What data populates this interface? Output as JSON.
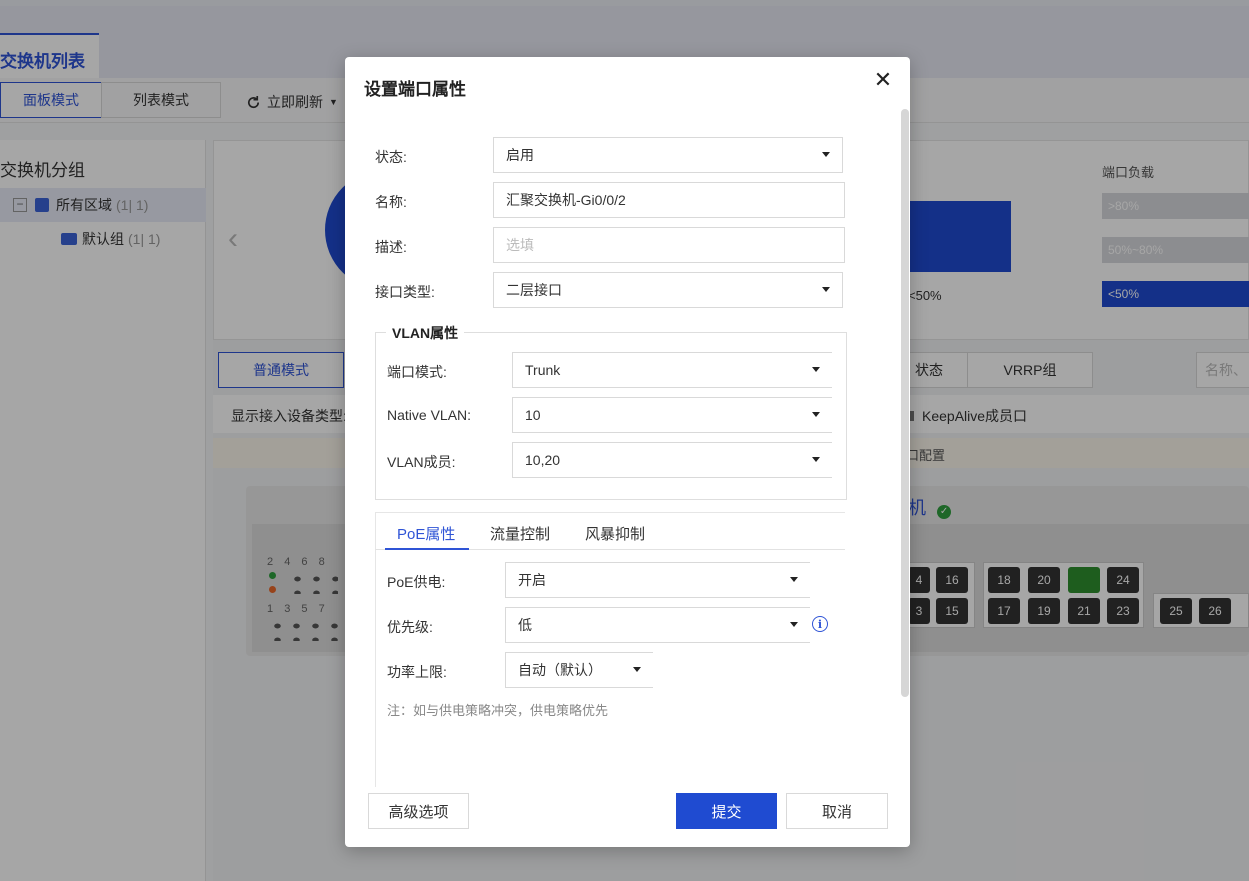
{
  "background": {
    "tab_title": "交换机列表",
    "modes": [
      "面板模式",
      "列表模式"
    ],
    "refresh_label": "立即刷新",
    "left_title": "交换机分组",
    "tree": [
      {
        "label": "所有区域",
        "count": "(1| 1)"
      },
      {
        "label": "默认组",
        "count": "(1| 1)"
      }
    ],
    "load_title": "端口负载",
    "load_levels": [
      ">80%",
      "50%~80%",
      "<50%"
    ],
    "chart_legend": "<50%",
    "view_tabs": [
      "普通模式",
      "状态",
      "VRRP组"
    ],
    "search_placeholder": "名称、",
    "filter_label": "显示接入设备类型:",
    "keepalive_label": "KeepAlive成员口",
    "note_text": "口配置",
    "device_name_suffix": "机",
    "port_numbers_top": [
      "2",
      "4",
      "6",
      "8"
    ],
    "port_numbers_bottom": [
      "1",
      "3",
      "5",
      "7"
    ],
    "ports_row1": [
      "4",
      "16",
      "18",
      "20",
      "",
      "24"
    ],
    "ports_row2": [
      "3",
      "15",
      "17",
      "19",
      "21",
      "23",
      "25",
      "26"
    ]
  },
  "modal": {
    "title": "设置端口属性",
    "fields": {
      "status_label": "状态:",
      "status_value": "启用",
      "name_label": "名称:",
      "name_value": "汇聚交换机-Gi0/0/2",
      "desc_label": "描述:",
      "desc_placeholder": "选填",
      "iftype_label": "接口类型:",
      "iftype_value": "二层接口"
    },
    "vlan": {
      "legend": "VLAN属性",
      "mode_label": "端口模式:",
      "mode_value": "Trunk",
      "native_label": "Native VLAN:",
      "native_value": "10",
      "members_label": "VLAN成员:",
      "members_value": "10,20"
    },
    "tabs": [
      "PoE属性",
      "流量控制",
      "风暴抑制"
    ],
    "poe": {
      "power_label": "PoE供电:",
      "power_value": "开启",
      "priority_label": "优先级:",
      "priority_value": "低",
      "limit_label": "功率上限:",
      "limit_value": "自动（默认）",
      "hint": "注：如与供电策略冲突，供电策略优先"
    },
    "buttons": {
      "advanced": "高级选项",
      "submit": "提交",
      "cancel": "取消"
    }
  }
}
